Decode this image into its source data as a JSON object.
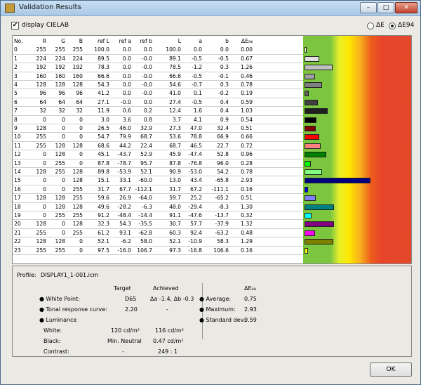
{
  "window": {
    "title": "Validation Results",
    "min": "–",
    "max": "□",
    "close": "✕"
  },
  "options": {
    "checkbox_label": "display CIELAB",
    "checkbox_checked": true,
    "radio_de": "ΔE",
    "radio_de94": "ΔE94",
    "selected": "ΔE94"
  },
  "table": {
    "headers": [
      "No.",
      "R",
      "G",
      "B",
      "ref L",
      "ref a",
      "ref b",
      "L",
      "a",
      "b",
      "ΔE₉₄"
    ],
    "rows": [
      [
        "0",
        "255",
        "255",
        "255",
        "100.0",
        "0.0",
        "0.0",
        "100.0",
        "0.0",
        "0.0",
        "0.00",
        "#ffffff"
      ],
      [
        "1",
        "224",
        "224",
        "224",
        "89.5",
        "0.0",
        "-0.0",
        "89.1",
        "-0.5",
        "-0.5",
        "0.67",
        "#e0e0e0"
      ],
      [
        "2",
        "192",
        "192",
        "192",
        "78.3",
        "0.0",
        "-0.0",
        "78.5",
        "-1.2",
        "0.3",
        "1.26",
        "#c0c0c0"
      ],
      [
        "3",
        "160",
        "160",
        "160",
        "66.6",
        "0.0",
        "-0.0",
        "66.6",
        "-0.5",
        "-0.1",
        "0.46",
        "#a0a0a0"
      ],
      [
        "4",
        "128",
        "128",
        "128",
        "54.3",
        "0.0",
        "-0.0",
        "54.6",
        "-0.7",
        "0.3",
        "0.78",
        "#808080"
      ],
      [
        "5",
        "96",
        "96",
        "96",
        "41.2",
        "0.0",
        "-0.0",
        "41.0",
        "0.1",
        "-0.2",
        "0.19",
        "#606060"
      ],
      [
        "6",
        "64",
        "64",
        "64",
        "27.1",
        "-0.0",
        "0.0",
        "27.4",
        "-0.5",
        "0.4",
        "0.59",
        "#404040"
      ],
      [
        "7",
        "32",
        "32",
        "32",
        "11.9",
        "0.6",
        "0.2",
        "12.4",
        "1.6",
        "0.4",
        "1.03",
        "#202020"
      ],
      [
        "8",
        "0",
        "0",
        "0",
        "3.0",
        "3.6",
        "0.8",
        "3.7",
        "4.1",
        "0.9",
        "0.54",
        "#000000"
      ],
      [
        "9",
        "128",
        "0",
        "0",
        "26.5",
        "46.0",
        "32.9",
        "27.3",
        "47.0",
        "32.4",
        "0.51",
        "#800000"
      ],
      [
        "10",
        "255",
        "0",
        "0",
        "54.7",
        "79.9",
        "68.7",
        "53.6",
        "78.8",
        "66.9",
        "0.66",
        "#ff0000"
      ],
      [
        "11",
        "255",
        "128",
        "128",
        "68.6",
        "44.2",
        "22.4",
        "68.7",
        "46.5",
        "22.7",
        "0.72",
        "#ff8080"
      ],
      [
        "12",
        "0",
        "128",
        "0",
        "45.1",
        "-43.7",
        "52.9",
        "45.9",
        "-47.4",
        "52.8",
        "0.96",
        "#008000"
      ],
      [
        "13",
        "0",
        "255",
        "0",
        "87.8",
        "-78.7",
        "95.7",
        "87.8",
        "-76.8",
        "96.0",
        "0.28",
        "#00ff00"
      ],
      [
        "14",
        "128",
        "255",
        "128",
        "89.8",
        "-53.9",
        "52.1",
        "90.9",
        "-53.0",
        "54.2",
        "0.78",
        "#80ff80"
      ],
      [
        "15",
        "0",
        "0",
        "128",
        "15.1",
        "33.1",
        "-60.0",
        "13.0",
        "43.4",
        "-65.8",
        "2.93",
        "#000080"
      ],
      [
        "16",
        "0",
        "0",
        "255",
        "31.7",
        "67.7",
        "-112.1",
        "31.7",
        "67.2",
        "-111.1",
        "0.16",
        "#0000ff"
      ],
      [
        "17",
        "128",
        "128",
        "255",
        "59.6",
        "26.9",
        "-64.0",
        "59.7",
        "25.2",
        "-65.2",
        "0.51",
        "#8080ff"
      ],
      [
        "18",
        "0",
        "128",
        "128",
        "49.6",
        "-28.2",
        "-6.3",
        "48.0",
        "-29.4",
        "-8.3",
        "1.30",
        "#008080"
      ],
      [
        "19",
        "0",
        "255",
        "255",
        "91.2",
        "-48.4",
        "-14.4",
        "91.1",
        "-47.6",
        "-13.7",
        "0.32",
        "#00ffff"
      ],
      [
        "20",
        "128",
        "0",
        "128",
        "32.3",
        "54.3",
        "-35.5",
        "30.7",
        "57.7",
        "-37.9",
        "1.32",
        "#800080"
      ],
      [
        "21",
        "255",
        "0",
        "255",
        "61.2",
        "93.1",
        "-62.8",
        "60.3",
        "92.4",
        "-63.2",
        "0.48",
        "#ff00ff"
      ],
      [
        "22",
        "128",
        "128",
        "0",
        "52.1",
        "-6.2",
        "58.0",
        "52.1",
        "-10.9",
        "58.3",
        "1.29",
        "#808000"
      ],
      [
        "23",
        "255",
        "255",
        "0",
        "97.5",
        "-16.0",
        "106.7",
        "97.3",
        "-16.8",
        "106.6",
        "0.16",
        "#ffff00"
      ]
    ]
  },
  "summary": {
    "profile_label": "Profile:",
    "profile_value": "DISPLAY1_1-001.icm",
    "target_label": "Target",
    "achieved_label": "Achieved",
    "de_label": "ΔE₉₄",
    "white_point_label": "White Point:",
    "white_point_target": "D65",
    "white_point_achieved": "Δa -1.4, Δb -0.3",
    "tonal_label": "Tonal response curve:",
    "tonal_target": "2.20",
    "tonal_achieved": "-",
    "luminance_label": "Luminance",
    "white_label": "White:",
    "white_target": "120 cd/m²",
    "white_achieved": "116 cd/m²",
    "black_label": "Black:",
    "black_target": "Min. Neutral",
    "black_achieved": "0.47 cd/m²",
    "contrast_label": "Contrast:",
    "contrast_target": "-",
    "contrast_achieved": "249 : 1",
    "average_label": "Average:",
    "average_value": "0.75",
    "maximum_label": "Maximum:",
    "maximum_value": "2.93",
    "std_label": "Standard dev.:",
    "std_value": "0.59"
  },
  "buttons": {
    "ok": "OK"
  }
}
